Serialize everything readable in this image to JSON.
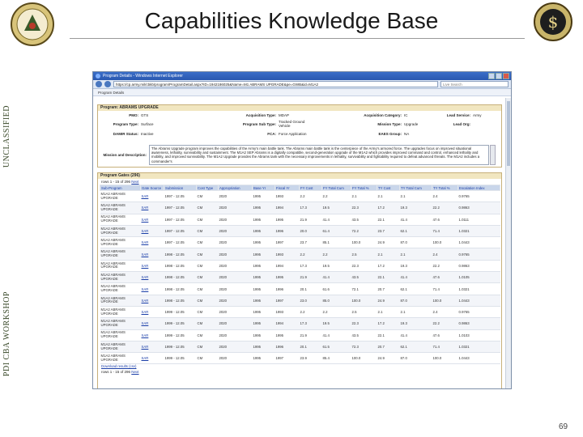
{
  "slide": {
    "title": "Capabilities Knowledge Base",
    "side_upper": "UNCLASSIFIED",
    "side_lower": "PDI CBA WORKSHOP",
    "page_number": "69"
  },
  "browser": {
    "window_title": "Program Details - Windows Internet Explorer",
    "address": "https://cp.army.mil/cbkb/program/ProgramDetail.aspx?ID=1942186025&Name=M1 ABRAMS UPGRADE&pe=GWB&id=M1A2",
    "search_placeholder": "Live Search",
    "favorites_tab": "Program Details"
  },
  "program": {
    "header": "Program: ABRAMS UPGRADE",
    "fields": {
      "pmo_label": "PMO:",
      "pmo_value": "GTS",
      "acq_type_label": "Acquisition Type:",
      "acq_type_value": "MDAP",
      "acq_cat_label": "Acquisition Category:",
      "acq_cat_value": "IC",
      "lead_svc_label": "Lead Service:",
      "lead_svc_value": "Army",
      "prog_type_label": "Program Type:",
      "prog_type_value": "Surface",
      "sub_type_label": "Program Sub Type:",
      "sub_type_value": "Tracked Ground Vehicle",
      "mission_type_label": "Mission Type:",
      "mission_type_value": "Upgrade",
      "lead_org_label": "Lead Org:",
      "lead_org_value": "",
      "damir_label": "DAMIR Status:",
      "damir_value": "Inactive",
      "fca_label": "FCA:",
      "fca_value": "Force Application",
      "eaes_label": "EAES Group:",
      "eaes_value": "NA",
      "mission_label": "Mission and Description:"
    },
    "description": "The Abrams Upgrade program improves the capabilities of the Army's main battle tank. The Abrams main battle tank is the centerpiece of the Army's armored force. The upgrades focus on improved situational awareness, lethality, survivability and sustainment. The M1A2 SEP Abrams is a digitally compatible, second-generation upgrade of the M1A2 which provides improved command and control, enhanced lethality and mobility, and improved survivability. The M1A2 Upgrade provides the Abrams tank with the necessary improvements in lethality, survivability and fightability required to defeat advanced threats. The M1A2 includes a commander's"
  },
  "gates": {
    "header": "Program Gates (296)",
    "pager_text": "rows 1 - 15 of 296",
    "next_label": "Next",
    "columns": [
      "Sub-Program",
      "Gate Source",
      "Submission",
      "Cost Type",
      "Appropriation",
      "Base Yr",
      "Fiscal Yr",
      "FY Cost",
      "FY Total Cum",
      "FY Total %",
      "TY Cost",
      "TY Total Cum",
      "TY Total %",
      "Escalation Index"
    ],
    "rows": [
      [
        "M1A2 ABRAMS UPGRADE",
        "SAR",
        "1997 - 12.05",
        "CM",
        "2020",
        "1995",
        "1993",
        "2.2",
        "2.2",
        "2.1",
        "2.1",
        "2.1",
        "2.4",
        "0.9765"
      ],
      [
        "M1A2 ABRAMS UPGRADE",
        "SAR",
        "1997 - 12.05",
        "CM",
        "2020",
        "1995",
        "1994",
        "17.3",
        "19.5",
        "22.3",
        "17.2",
        "19.3",
        "22.2",
        "0.9863"
      ],
      [
        "M1A2 ABRAMS UPGRADE",
        "SAR",
        "1997 - 12.05",
        "CM",
        "2020",
        "1995",
        "1995",
        "21.9",
        "41.4",
        "43.5",
        "22.1",
        "41.4",
        "47.6",
        "1.0111"
      ],
      [
        "M1A2 ABRAMS UPGRADE",
        "SAR",
        "1997 - 12.05",
        "CM",
        "2020",
        "1995",
        "1996",
        "20.0",
        "61.4",
        "72.2",
        "23.7",
        "62.1",
        "71.4",
        "1.0321"
      ],
      [
        "M1A2 ABRAMS UPGRADE",
        "SAR",
        "1997 - 12.05",
        "CM",
        "2020",
        "1995",
        "1997",
        "23.7",
        "85.1",
        "100.0",
        "24.9",
        "87.0",
        "100.0",
        "1.0443"
      ],
      [
        "M1A2 ABRAMS UPGRADE",
        "SAR",
        "1998 - 12.05",
        "CM",
        "2020",
        "1995",
        "1993",
        "2.2",
        "2.2",
        "2.5",
        "2.1",
        "2.1",
        "2.4",
        "0.9765"
      ],
      [
        "M1A2 ABRAMS UPGRADE",
        "SAR",
        "1998 - 12.05",
        "CM",
        "2020",
        "1995",
        "1994",
        "17.3",
        "19.5",
        "22.3",
        "17.2",
        "19.3",
        "22.2",
        "0.9863"
      ],
      [
        "M1A2 ABRAMS UPGRADE",
        "SAR",
        "1998 - 12.05",
        "CM",
        "2020",
        "1995",
        "1995",
        "21.9",
        "41.4",
        "43.5",
        "22.1",
        "41.4",
        "47.6",
        "1.0105"
      ],
      [
        "M1A2 ABRAMS UPGRADE",
        "SAR",
        "1998 - 12.05",
        "CM",
        "2020",
        "1995",
        "1996",
        "20.1",
        "61.6",
        "72.1",
        "20.7",
        "62.1",
        "71.4",
        "1.0321"
      ],
      [
        "M1A2 ABRAMS UPGRADE",
        "SAR",
        "1998 - 12.05",
        "CM",
        "2020",
        "1995",
        "1997",
        "23.0",
        "85.0",
        "100.0",
        "24.9",
        "87.0",
        "100.0",
        "1.0443"
      ],
      [
        "M1A2 ABRAMS UPGRADE",
        "SAR",
        "1999 - 12.05",
        "CM",
        "2020",
        "1995",
        "1993",
        "2.2",
        "2.2",
        "2.5",
        "2.1",
        "2.1",
        "2.4",
        "0.9765"
      ],
      [
        "M1A2 ABRAMS UPGRADE",
        "SAR",
        "1999 - 12.05",
        "CM",
        "2020",
        "1995",
        "1994",
        "17.3",
        "19.5",
        "22.3",
        "17.2",
        "19.3",
        "22.2",
        "0.9863"
      ],
      [
        "M1A2 ABRAMS UPGRADE",
        "SAR",
        "1999 - 12.05",
        "CM",
        "2020",
        "1995",
        "1995",
        "21.9",
        "41.4",
        "43.5",
        "22.1",
        "41.4",
        "47.6",
        "1.0103"
      ],
      [
        "M1A2 ABRAMS UPGRADE",
        "SAR",
        "1999 - 12.05",
        "CM",
        "2020",
        "1995",
        "1996",
        "20.1",
        "61.5",
        "72.3",
        "20.7",
        "62.1",
        "71.4",
        "1.0321"
      ],
      [
        "M1A2 ABRAMS UPGRADE",
        "SAR",
        "1999 - 12.05",
        "CM",
        "2020",
        "1995",
        "1997",
        "23.9",
        "85.4",
        "100.0",
        "24.9",
        "87.0",
        "100.0",
        "1.0443"
      ]
    ],
    "download_label": "Download results (csv)",
    "pager_bottom": "rows 1 - 15 of 296"
  },
  "colors": {
    "title_bar": "#2a58b0",
    "panel_header": "#f1e6c0",
    "grid_header": "#c9d6ea",
    "link": "#1a3ea8"
  }
}
